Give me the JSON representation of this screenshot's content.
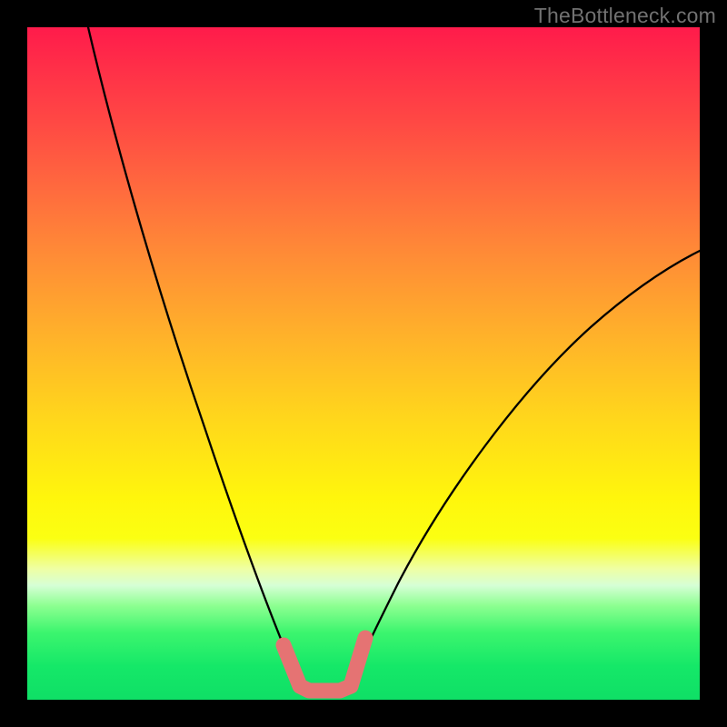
{
  "watermark": "TheBottleneck.com",
  "colors": {
    "frame": "#000000",
    "gradient_top": "#ff1b4b",
    "gradient_mid": "#fff60c",
    "gradient_bottom": "#0fdf66",
    "curve": "#000000",
    "valley_highlight": "#e57373"
  },
  "chart_data": {
    "type": "line",
    "title": "",
    "xlabel": "",
    "ylabel": "",
    "xlim": [
      0,
      100
    ],
    "ylim": [
      0,
      100
    ],
    "series": [
      {
        "name": "left_branch",
        "x": [
          9,
          12,
          16,
          20,
          24,
          28,
          31,
          34,
          36,
          38,
          39.5,
          40.5
        ],
        "y": [
          100,
          85,
          70,
          56,
          43,
          31,
          22,
          14,
          9,
          5,
          3,
          2
        ]
      },
      {
        "name": "right_branch",
        "x": [
          47,
          49,
          52,
          56,
          61,
          68,
          76,
          85,
          93,
          100
        ],
        "y": [
          2,
          5,
          10,
          17,
          25,
          35,
          45,
          54,
          61,
          67
        ]
      },
      {
        "name": "valley_highlight",
        "x": [
          38,
          40,
          42,
          44,
          46,
          48,
          50
        ],
        "y": [
          8,
          3,
          1.5,
          1.5,
          1.5,
          3,
          9
        ]
      }
    ],
    "annotations": [
      {
        "text": "TheBottleneck.com",
        "position": "top-right"
      }
    ]
  }
}
